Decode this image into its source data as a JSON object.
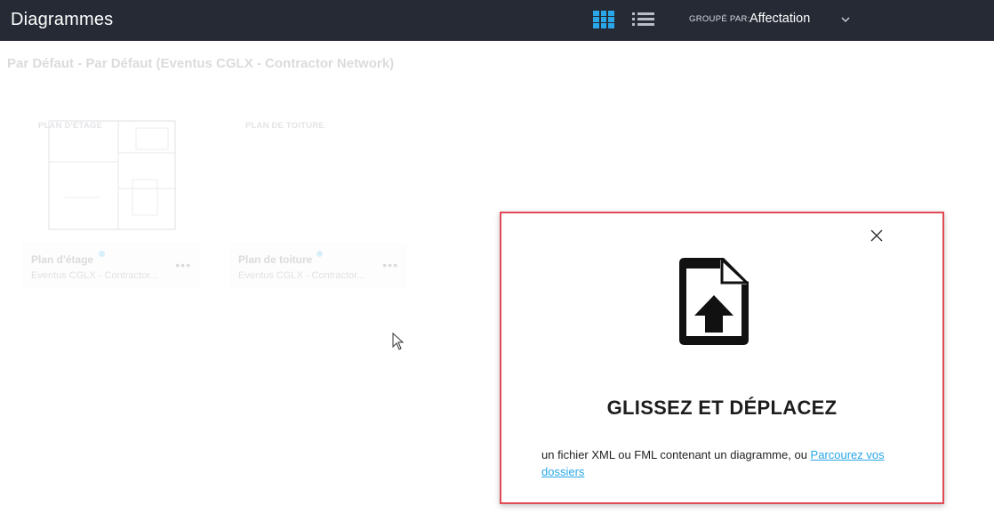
{
  "header": {
    "title": "Diagrammes",
    "group_by_label": "GROUPÉ PAR:",
    "group_by_value": "Affectation",
    "view_icons": [
      "grid-view-icon",
      "list-view-icon"
    ],
    "accent_color": "#2aa7e8",
    "background_color": "#252a35"
  },
  "main": {
    "section_title": "Par Défaut - Par Défaut (Eventus CGLX - Contractor Network)",
    "cards": [
      {
        "thumbnail_label": "PLAN D'ÉTAGE",
        "name": "Plan d'étage",
        "subtitle": "Eventus CGLX - Contractor..."
      },
      {
        "thumbnail_label": "PLAN DE TOITURE",
        "name": "Plan de toiture",
        "subtitle": "Eventus CGLX - Contractor..."
      }
    ]
  },
  "dialog": {
    "icon": "file-upload-icon",
    "title": "GLISSEZ ET DÉPLACEZ",
    "description": "un fichier XML ou FML contenant un diagramme, ou ",
    "browse_link": "Parcourez vos dossiers",
    "border_color": "#e24b55"
  }
}
